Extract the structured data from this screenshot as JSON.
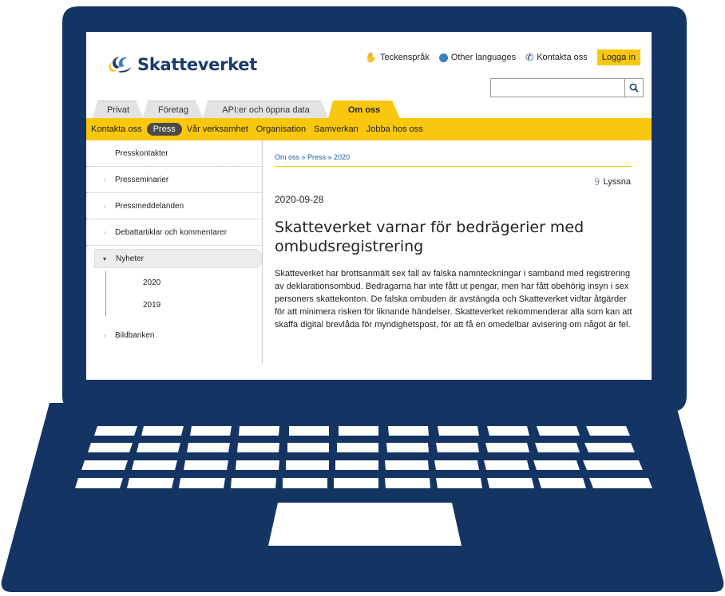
{
  "header": {
    "logo_text": "Skatteverket",
    "links": {
      "sign_language": "Teckenspråk",
      "other_languages": "Other languages",
      "contact": "Kontakta oss"
    },
    "login_label": "Logga in",
    "search_placeholder": ""
  },
  "tabs": [
    {
      "label": "Privat"
    },
    {
      "label": "Företag"
    },
    {
      "label": "API:er och öppna data"
    },
    {
      "label": "Om oss"
    }
  ],
  "subnav": [
    {
      "label": "Kontakta oss"
    },
    {
      "label": "Press"
    },
    {
      "label": "Vår verksamhet"
    },
    {
      "label": "Organisation"
    },
    {
      "label": "Samverkan"
    },
    {
      "label": "Jobba hos oss"
    }
  ],
  "sidebar": {
    "items": [
      {
        "label": "Presskontakter"
      },
      {
        "label": "Presseminarier"
      },
      {
        "label": "Pressmeddelanden"
      },
      {
        "label": "Debattartiklar och kommentarer"
      },
      {
        "label": "Nyheter"
      },
      {
        "label": "2020"
      },
      {
        "label": "2019"
      },
      {
        "label": "Bildbanken"
      }
    ]
  },
  "content": {
    "breadcrumb": "Om oss » Press » 2020",
    "listen_label": "Lyssna",
    "date": "2020-09-28",
    "headline": "Skatteverket varnar för bedrägerier med ombudsregistrering",
    "body": "Skatteverket har brottsanmält sex fall av falska namnteckningar i samband med registrering av deklarationsombud. Bedragarna har inte fått ut pengar, men har fått obehörig insyn i sex personers skattekonton. De falska ombuden är avstängda och Skatteverket vidtar åtgärder för att minimera risken för liknande händelser. Skatteverket rekommenderar alla som kan att skaffa digital brevlåda för myndighetspost, för att få en omedelbar avisering om något är fel."
  },
  "colors": {
    "laptop": "#143463",
    "accent_yellow": "#f9c80e",
    "brand_blue": "#1a3a6b"
  }
}
